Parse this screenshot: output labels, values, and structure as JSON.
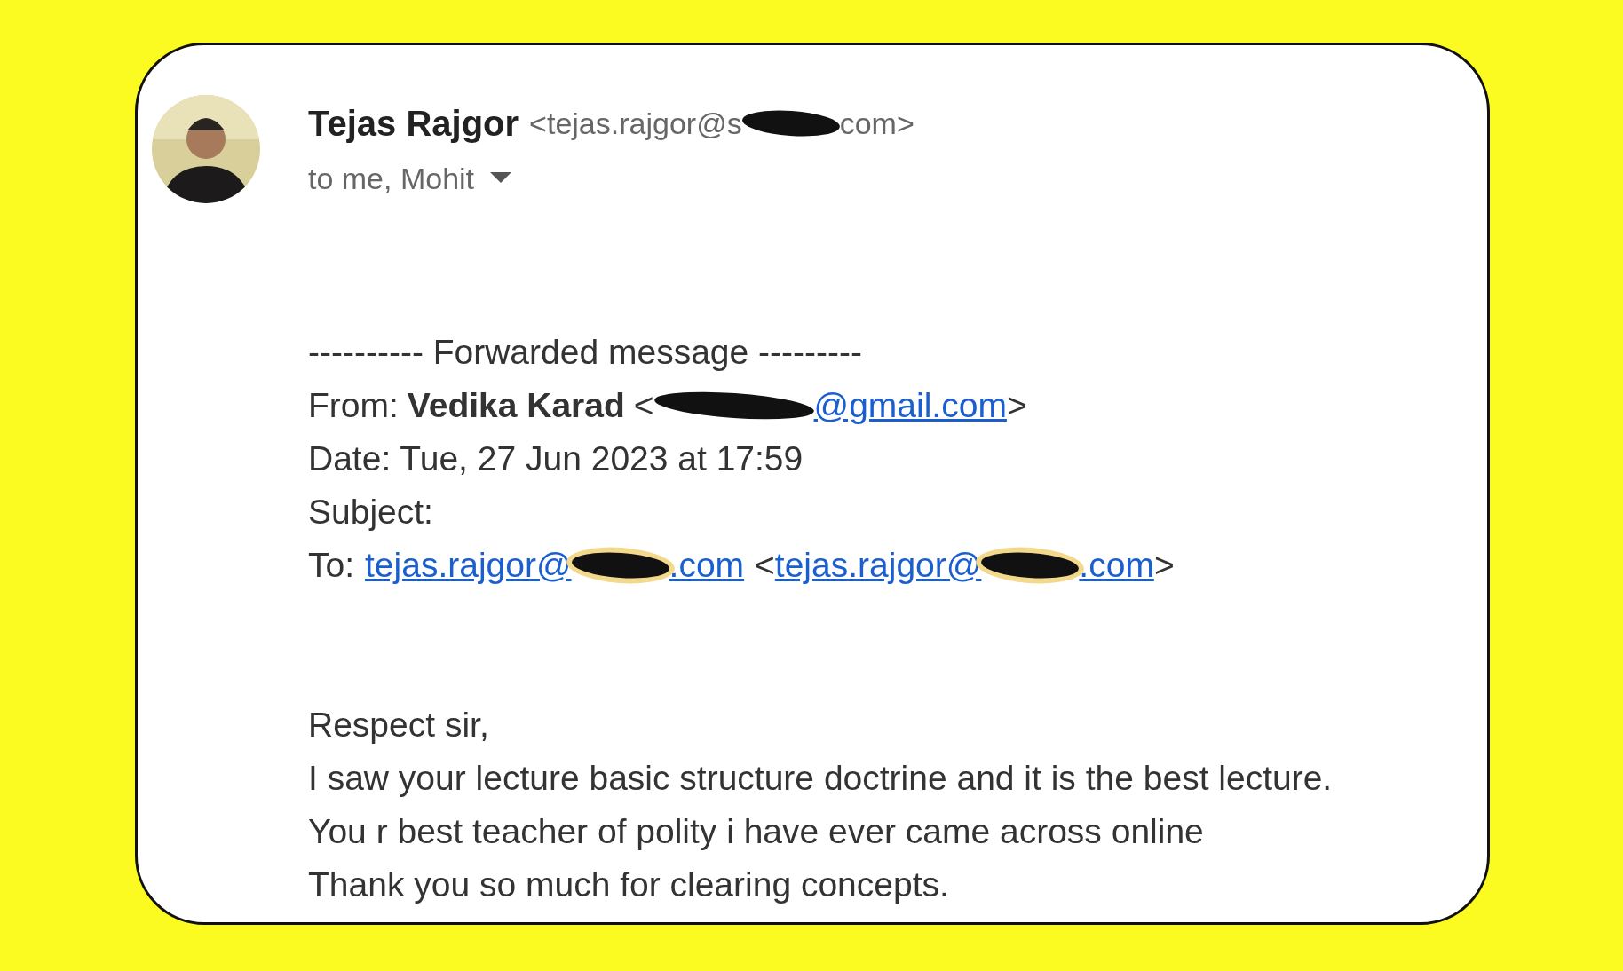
{
  "sender": {
    "name": "Tejas Rajgor",
    "email": {
      "start": "<tejas.rajgor@s",
      "redacted": true,
      "end": "com>"
    },
    "recipients": "to me, Mohit"
  },
  "forwarded": {
    "header": "---------- Forwarded message ---------",
    "from": {
      "label": "From:",
      "name": "Vedika Karad",
      "open": "<",
      "link": {
        "redacted": true,
        "end": "@gmail.com"
      },
      "close": ">"
    },
    "date": "Date: Tue, 27 Jun 2023 at 17:59",
    "subject": "Subject:",
    "to": {
      "label": "To:",
      "links": [
        {
          "start": "tejas.rajgor@",
          "redacted": true,
          "end": ".com"
        },
        {
          "open": "<",
          "start": "tejas.rajgor@",
          "redacted": true,
          "end": ".com",
          "close": ">"
        }
      ]
    }
  },
  "body": [
    "Respect sir,",
    "I saw your lecture basic structure doctrine and it is the best lecture.",
    "You r best teacher of polity i have ever came across online",
    "Thank you so much for clearing concepts."
  ]
}
